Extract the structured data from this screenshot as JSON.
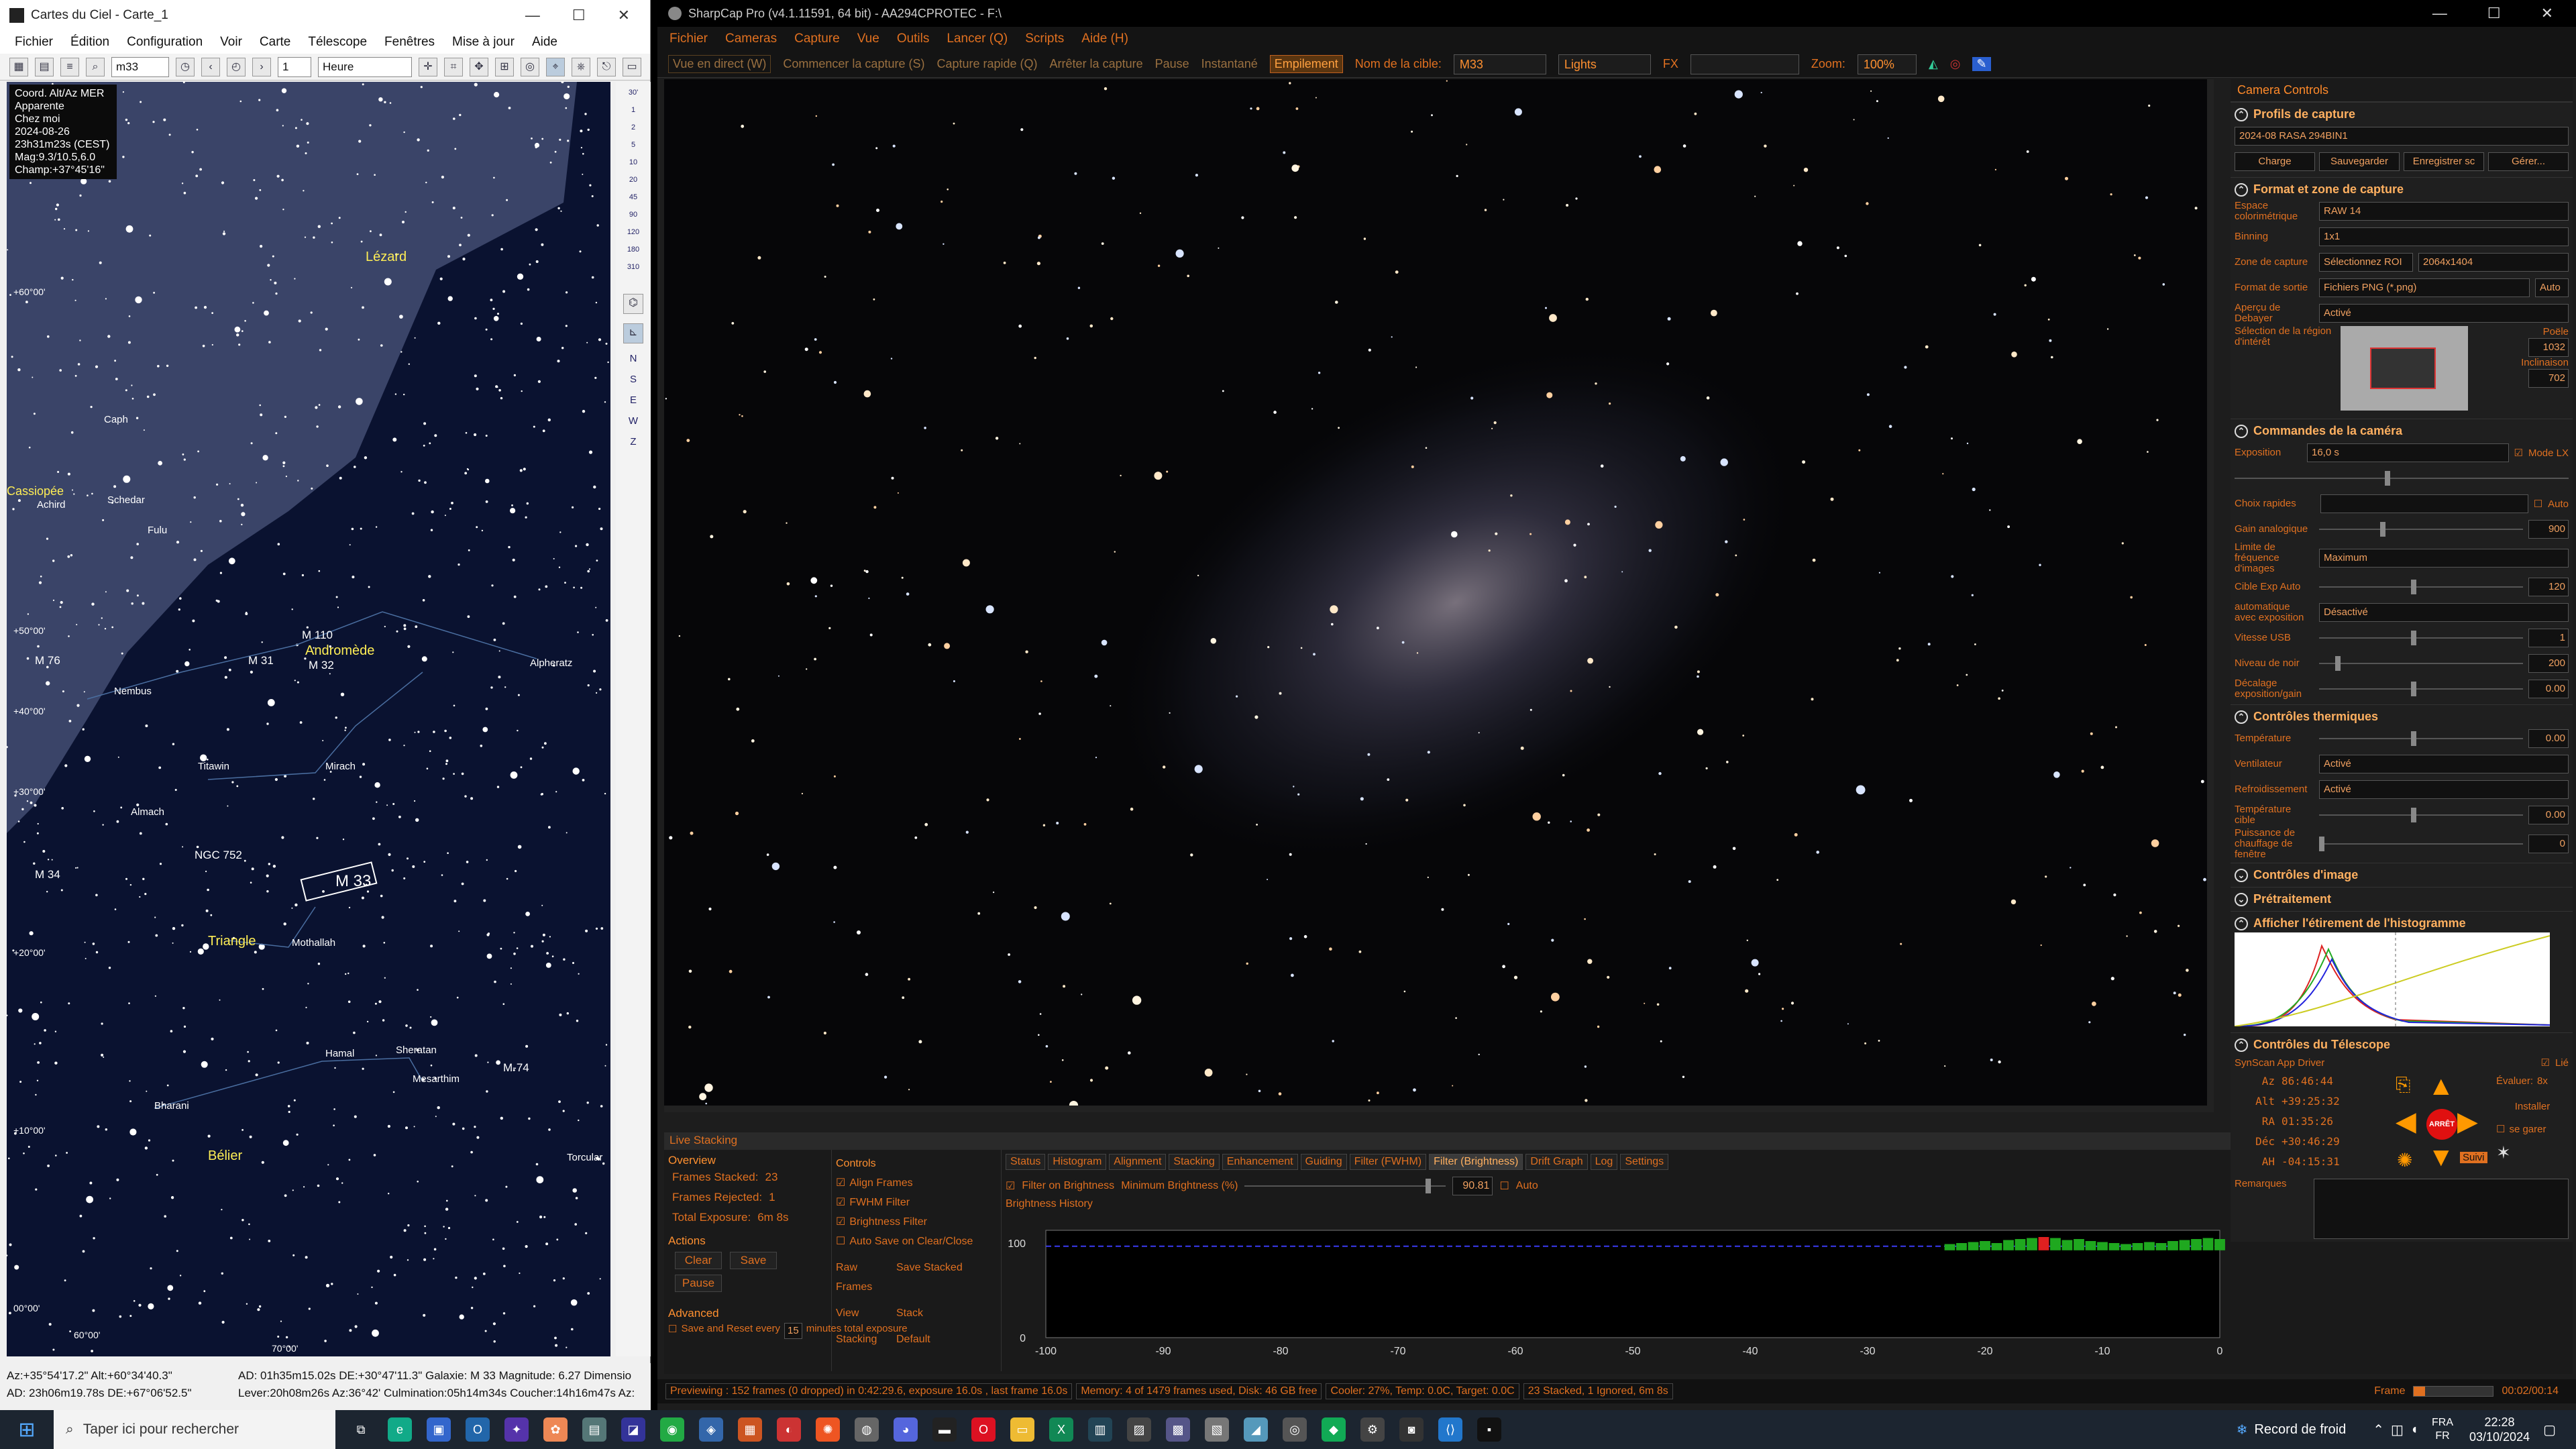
{
  "cdc": {
    "title": "Cartes du Ciel - Carte_1",
    "menu": [
      "Fichier",
      "Édition",
      "Configuration",
      "Voir",
      "Carte",
      "Télescope",
      "Fenêtres",
      "Mise à jour",
      "Aide"
    ],
    "search_value": "m33",
    "spin_value": "1",
    "time_unit": "Heure",
    "info": [
      "Coord. Alt/Az MER",
      "Apparente",
      "Chez moi",
      "2024-08-26",
      "23h31m23s (CEST)",
      "Mag:9.3/10.5,6.0",
      "Champ:+37°45'16\""
    ],
    "labels": {
      "lezard": "Lézard",
      "caph": "Caph",
      "cassiopee": "Cassiopée",
      "schedar": "Schedar",
      "achird": "Achird",
      "fulu": "Fulu",
      "m110": "M 110",
      "andromede": "Andromède",
      "m31": "M 31",
      "m32": "M 32",
      "m76": "M 76",
      "nembus": "Nembus",
      "alpheratz": "Alpheratz",
      "titawin": "Titawin",
      "mirach": "Mirach",
      "almach": "Almach",
      "ngc752": "NGC 752",
      "m34": "M 34",
      "m33": "M 33",
      "triangle": "Triangle",
      "mothallah": "Mothallah",
      "hamal": "Hamal",
      "sheratan": "Sheratan",
      "mesarthim": "Mesarthim",
      "m74": "M-74",
      "bharani": "Bharani",
      "belier": "Bélier",
      "torcular": "Torcular"
    },
    "dec_labels": [
      "+60°00'",
      "+50°00'",
      "+40°00'",
      "+30°00'",
      "+20°00'",
      "+10°00'",
      "00°00'"
    ],
    "ra_labels": [
      "60°00'",
      "70°00'"
    ],
    "strip_labels": [
      "30'",
      "1",
      "2",
      "5",
      "10",
      "20",
      "45",
      "90",
      "120",
      "180",
      "310",
      "N",
      "S",
      "E",
      "W",
      "Z"
    ],
    "status": {
      "altaz": "Az:+35°54'17.2\" Alt:+60°34'40.3\"",
      "ad": "AD: 23h06m19.78s DE:+67°06'52.5\"",
      "object1": "AD: 01h35m15.02s DE:+30°47'11.3\"  Galaxie: M 33  Magnitude:  6.27  Dimensio",
      "object2": "Lever:20h08m26s Az:36°42'  Culmination:05h14m34s  Coucher:14h16m47s Az:"
    }
  },
  "sharpcap": {
    "title": "SharpCap Pro (v4.1.11591, 64 bit) - AA294CPROTEC - F:\\",
    "menu": [
      "Fichier",
      "Cameras",
      "Capture",
      "Vue",
      "Outils",
      "Lancer (Q)",
      "Scripts",
      "Aide (H)"
    ],
    "toolbar": {
      "live": "Vue en direct (W)",
      "start": "Commencer la capture (S)",
      "quick": "Capture rapide (Q)",
      "stop": "Arrêter la capture",
      "pause": "Pause",
      "instant": "Instantané",
      "stacking": "Empilement",
      "target_label": "Nom de la cible:",
      "target": "M33",
      "frametype": "Lights",
      "fx": "FX",
      "zoom_label": "Zoom:",
      "zoom": "100%"
    },
    "camera_controls": {
      "header": "Camera Controls",
      "profiles": {
        "title": "Profils de capture",
        "value": "2024-08 RASA 294BIN1",
        "load": "Charge",
        "save": "Sauvegarder",
        "saveas": "Enregistrer sc",
        "manage": "Gérer..."
      },
      "format": {
        "title": "Format et zone de capture",
        "colorspace_label": "Espace colorimétrique",
        "colorspace": "RAW 14",
        "binning_label": "Binning",
        "binning": "1x1",
        "zone_label": "Zone de capture",
        "roi": "Sélectionnez ROI",
        "resolution": "2064x1404",
        "output_label": "Format de sortie",
        "output": "Fichiers PNG (*.png)",
        "auto": "Auto",
        "debayer_label": "Aperçu de Debayer",
        "debayer": "Activé",
        "roi_label": "Sélection de la région d'intérêt",
        "poele_label": "Poële",
        "poele": "1032",
        "incl_label": "Inclinaison",
        "incl": "702"
      },
      "camera": {
        "title": "Commandes de la caméra",
        "exposure_label": "Exposition",
        "exposure": "16,0 s",
        "lx": "Mode LX",
        "quick_label": "Choix rapides",
        "auto": "Auto",
        "gain_label": "Gain analogique",
        "gain": "900",
        "fps_label": "Limite de fréquence d'images",
        "fps": "Maximum",
        "target_label": "Cible Exp Auto",
        "target": "120",
        "autoexp_label": "automatique avec exposition",
        "autoexp": "Désactivé",
        "usb_label": "Vitesse USB",
        "usb": "1",
        "black_label": "Niveau de noir",
        "black": "200",
        "offset_label": "Décalage exposition/gain",
        "offset": "0.00"
      },
      "thermal": {
        "title": "Contrôles thermiques",
        "temp_label": "Température",
        "temp": "0.00",
        "fan_label": "Ventilateur",
        "fan": "Activé",
        "cool_label": "Refroidissement",
        "cool": "Activé",
        "target_label": "Température cible",
        "target": "0.00",
        "heater_label": "Puissance de chauffage de fenêtre",
        "heater": "0"
      },
      "image_title": "Contrôles d'image",
      "preproc_title": "Prétraitement",
      "histogram_title": "Afficher l'étirement de l'histogramme",
      "telescope": {
        "title": "Contrôles du Télescope",
        "driver": "SynScan App Driver",
        "linked": "Lié",
        "az_label": "Az",
        "az": "86:46:44",
        "alt_label": "Alt",
        "alt": "+39:25:32",
        "ra_label": "RA",
        "ra": "01:35:26",
        "dec_label": "Déc",
        "dec": "+30:46:29",
        "ah_label": "AH",
        "ah": "-04:15:31",
        "rate_label": "Évaluer:",
        "rate": "8x",
        "install": "Installer",
        "park": "se garer",
        "follow": "Suivi",
        "stop": "ARRÊT",
        "remarks": "Remarques"
      }
    },
    "live_stacking": {
      "title": "Live Stacking",
      "overview": "Overview",
      "stacked_label": "Frames Stacked:",
      "stacked": "23",
      "rejected_label": "Frames Rejected:",
      "rejected": "1",
      "total_label": "Total Exposure:",
      "total": "6m 8s",
      "actions": "Actions",
      "clear": "Clear",
      "save": "Save",
      "pause": "Pause",
      "advanced": "Advanced",
      "save_reset": "Save and Reset every",
      "minutes_value": "15",
      "minutes_text": "minutes total exposure",
      "controls": "Controls",
      "align": "Align Frames",
      "fwhm": "FWHM Filter",
      "brightness": "Brightness Filter",
      "autosave": "Auto Save on Clear/Close",
      "raw_label": "Raw Frames",
      "raw": "Save Stacked",
      "view_label": "View",
      "view": "Stack",
      "stacking_label": "Stacking",
      "stacking": "Default",
      "tabs": [
        "Status",
        "Histogram",
        "Alignment",
        "Stacking",
        "Enhancement",
        "Guiding",
        "Filter (FWHM)",
        "Filter (Brightness)",
        "Drift Graph",
        "Log",
        "Settings"
      ],
      "filter_on": "Filter on Brightness",
      "min_label": "Minimum Brightness (%)",
      "min_value": "90.81",
      "auto": "Auto",
      "history": "Brightness History",
      "y_ticks": [
        "100",
        "0"
      ],
      "x_ticks": [
        "-100",
        "-90",
        "-80",
        "-70",
        "-60",
        "-50",
        "-40",
        "-30",
        "-20",
        "-10",
        "0"
      ]
    },
    "status": {
      "preview": "Previewing : 152 frames (0 dropped) in 0:42:29.6, exposure 16.0s , last frame 16.0s",
      "memory": "Memory: 4 of 1479 frames used, Disk: 46 GB free",
      "cooler": "Cooler: 27%, Temp: 0.0C, Target: 0.0C",
      "stack": "23 Stacked, 1 Ignored, 6m 8s",
      "frame_label": "Frame",
      "frame_time": "00:02/00:14"
    }
  },
  "taskbar": {
    "search": "Taper ici pour rechercher",
    "weather": "Record de froid",
    "lang1": "FRA",
    "lang2": "FR",
    "time": "22:28",
    "date": "03/10/2024"
  },
  "chart_data": {
    "type": "bar",
    "xlim": [
      -100,
      0
    ],
    "ylim": [
      0,
      100
    ],
    "threshold": 90.81,
    "x": [
      -23,
      -22,
      -21,
      -20,
      -19,
      -18,
      -17,
      -16,
      -15,
      -14,
      -13,
      -12,
      -11,
      -10,
      -9,
      -8,
      -7,
      -6,
      -5,
      -4,
      -3,
      -2,
      -1,
      0
    ],
    "values": [
      93,
      94,
      95,
      96,
      94,
      97,
      98,
      99,
      100,
      99,
      97,
      98,
      96,
      95,
      94,
      93,
      94,
      95,
      94,
      96,
      97,
      98,
      99,
      98
    ],
    "rejected_x": [
      -15
    ]
  }
}
